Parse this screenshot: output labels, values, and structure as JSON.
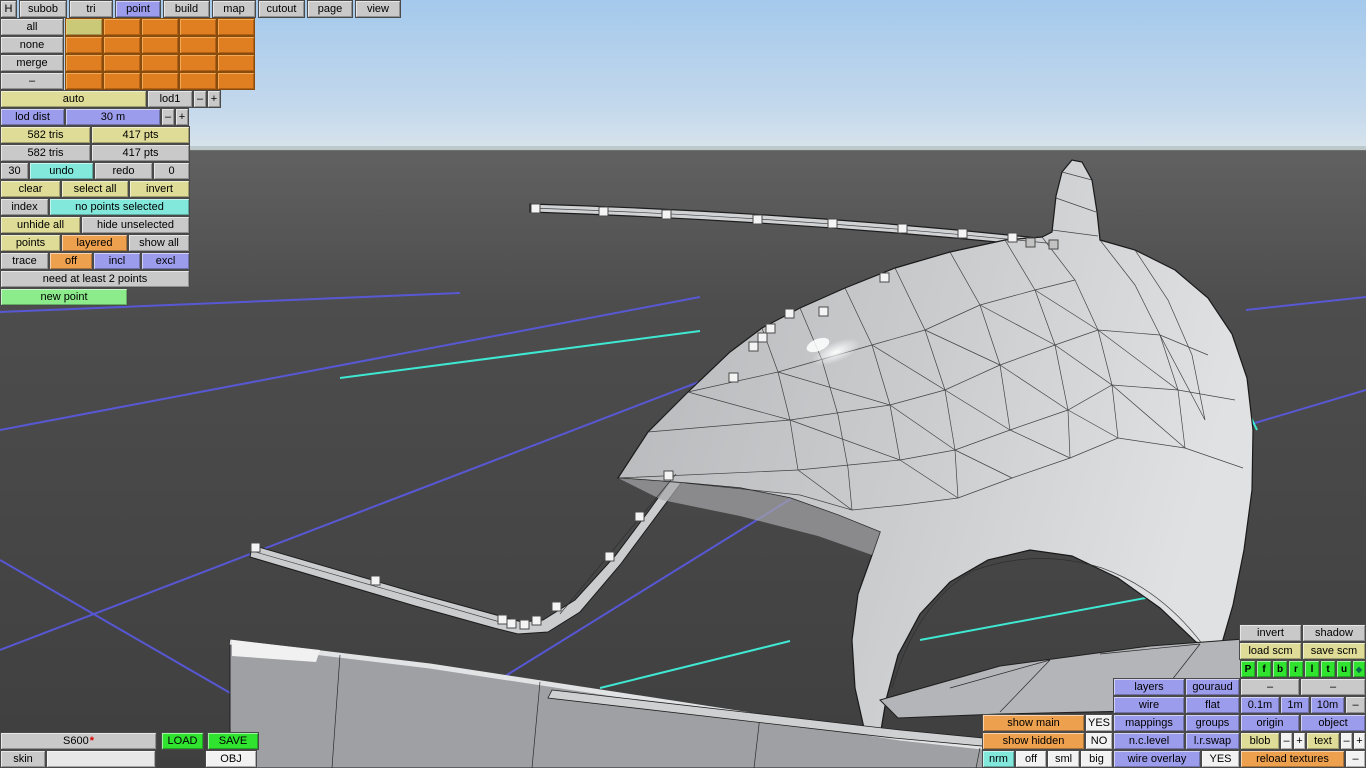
{
  "menubar": {
    "items": [
      {
        "label": "H"
      },
      {
        "label": "subob"
      },
      {
        "label": "tri"
      },
      {
        "label": "point",
        "active": true
      },
      {
        "label": "build"
      },
      {
        "label": "map"
      },
      {
        "label": "cutout"
      },
      {
        "label": "page"
      },
      {
        "label": "view"
      }
    ]
  },
  "left_panel": {
    "all": "all",
    "none": "none",
    "merge": "merge",
    "dash": "–",
    "auto": "auto",
    "lod": "lod1",
    "minus": "–",
    "plus": "+",
    "lod_dist_label": "lod dist",
    "lod_dist_value": "30 m",
    "tris_current": "582 tris",
    "pts_current": "417 pts",
    "tris_total": "582 tris",
    "pts_total": "417 pts",
    "undo_steps": "30",
    "undo": "undo",
    "redo": "redo",
    "redo_steps": "0",
    "clear": "clear",
    "select_all": "select all",
    "invert": "invert",
    "index": "index",
    "selection_status": "no points selected",
    "unhide_all": "unhide all",
    "hide_unselected": "hide unselected",
    "points": "points",
    "layered": "layered",
    "show_all": "show all",
    "trace": "trace",
    "off": "off",
    "incl": "incl",
    "excl": "excl",
    "hint": "need at least 2 points",
    "new_point": "new point"
  },
  "bottom_left": {
    "model_name": "S600",
    "modified_marker": "*",
    "load": "LOAD",
    "save": "SAVE",
    "skin": "skin",
    "skin_value": "",
    "obj": "OBJ"
  },
  "right_panel": {
    "invert": "invert",
    "shadow": "shadow",
    "load_scm": "load scm",
    "save_scm": "save scm",
    "flags": [
      "P",
      "f",
      "b",
      "r",
      "l",
      "t",
      "u",
      "◆"
    ],
    "layers": "layers",
    "gouraud": "gouraud",
    "dash": "–",
    "plus": "+",
    "wire": "wire",
    "flat": "flat",
    "dist_small": "0.1m",
    "dist_medium": "1m",
    "dist_large": "10m",
    "mappings": "mappings",
    "groups": "groups",
    "origin": "origin",
    "object": "object",
    "show_main": "show main",
    "show_main_value": "YES",
    "show_hidden": "show hidden",
    "show_hidden_value": "NO",
    "nc_level": "n.c.level",
    "lr_swap": "l.r.swap",
    "blob": "blob",
    "text_label": "text",
    "nrm": "nrm",
    "off": "off",
    "sml": "sml",
    "big": "big",
    "wire_overlay": "wire overlay",
    "wire_overlay_value": "YES",
    "reload_textures": "reload textures"
  }
}
